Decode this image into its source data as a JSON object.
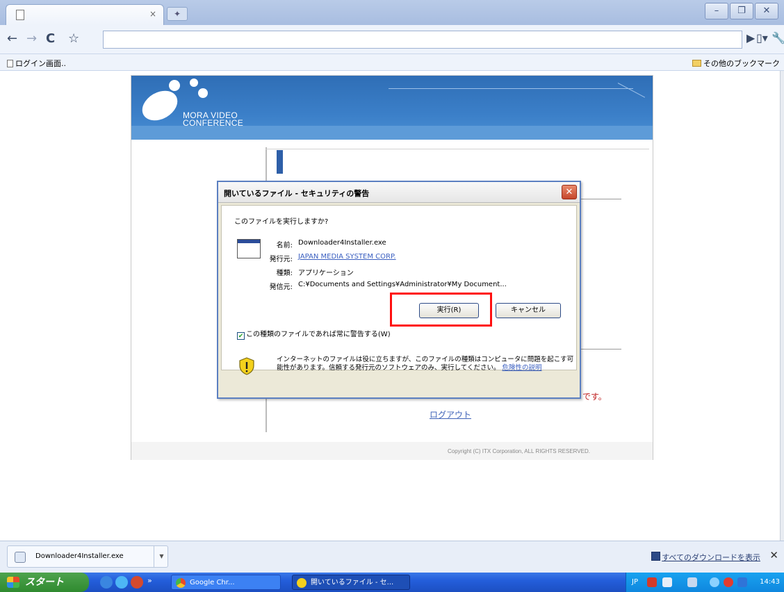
{
  "browser": {
    "tab_title": "",
    "tab_close": "×",
    "bookmarks": {
      "left_item": "ログイン画面..",
      "right_item": "その他のブックマーク"
    }
  },
  "page": {
    "logo_line1": "MORA VIDEO",
    "logo_line2": "CONFERENCE",
    "red_tail_text": "です。",
    "logout_link": "ログアウト",
    "copyright": "Copyright (C) ITX Corporation, ALL RIGHTS RESERVED."
  },
  "dialog": {
    "title": "開いているファイル - セキュリティの警告",
    "question": "このファイルを実行しますか?",
    "fields": [
      {
        "label": "名前:",
        "value": "Downloader4Installer.exe"
      },
      {
        "label": "発行元:",
        "value": "JAPAN MEDIA SYSTEM CORP."
      },
      {
        "label": "種類:",
        "value": "アプリケーション"
      },
      {
        "label": "発信元:",
        "value": "C:¥Documents and Settings¥Administrator¥My Document..."
      }
    ],
    "run_button": "実行(R)",
    "cancel_button": "キャンセル",
    "checkbox_label": "この種類のファイルであれば常に警告する(W)",
    "checkbox_checked": true,
    "warning_text": "インターネットのファイルは役に立ちますが、このファイルの種類はコンピュータに問題を起こす可能性があります。信頼する発行元のソフトウェアのみ、実行してください。",
    "warning_link": "危険性の説明"
  },
  "download_shelf": {
    "file_name": "Downloader4Installer.exe",
    "show_all": "すべてのダウンロードを表示"
  },
  "taskbar": {
    "start_label": "スタート",
    "tasks": [
      "Google Chr...",
      "開いているファイル - セ..."
    ],
    "tray_lang": "JP",
    "clock": "14:43"
  },
  "colors": {
    "highlight_box": "#ff1010",
    "site_header": "#2f6eb6",
    "taskbar": "#245edb"
  }
}
